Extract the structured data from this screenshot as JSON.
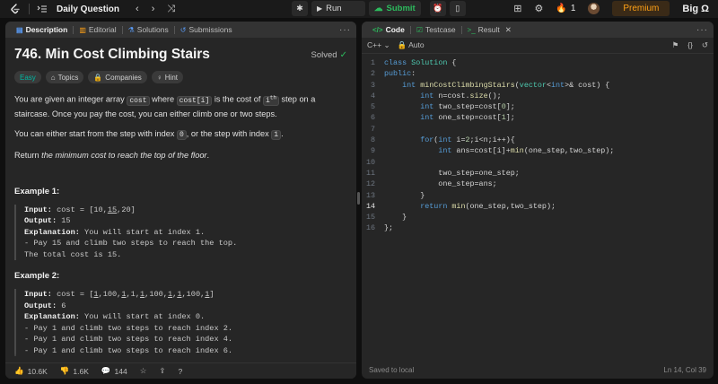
{
  "topbar": {
    "title": "Daily Question",
    "run_label": "Run",
    "submit_label": "Submit",
    "streak_count": "1",
    "premium_label": "Premium",
    "brand_text": "Big Ω"
  },
  "left_tabs": [
    {
      "label": "Description",
      "icon": "description-icon"
    },
    {
      "label": "Editorial",
      "icon": "editorial-icon"
    },
    {
      "label": "Solutions",
      "icon": "flask-icon"
    },
    {
      "label": "Submissions",
      "icon": "history-icon"
    }
  ],
  "problem": {
    "title": "746. Min Cost Climbing Stairs",
    "status": "Solved",
    "difficulty": "Easy",
    "tags": [
      "Topics",
      "Companies",
      "Hint"
    ],
    "p1_a": "You are given an integer array ",
    "p1_code1": "cost",
    "p1_b": " where ",
    "p1_code2": "cost[i]",
    "p1_c": " is the cost of ",
    "p1_code3": "i",
    "p1_sup": "th",
    "p1_d": " step on a staircase. Once you pay the cost, you can either climb one or two steps.",
    "p2_a": "You can either start from the step with index ",
    "p2_code1": "0",
    "p2_b": ", or the step with index ",
    "p2_code2": "1",
    "p2_c": ".",
    "p3_a": "Return ",
    "p3_em": "the minimum cost to reach the top of the floor",
    "p3_b": ".",
    "example1_title": "Example 1:",
    "example2_title": "Example 2:"
  },
  "example1": {
    "input_label": "Input:",
    "input_prefix": " cost = [10,",
    "input_ul": "15",
    "input_suffix": ",20]",
    "output_label": "Output:",
    "output_value": " 15",
    "expl_label": "Explanation:",
    "expl_text": " You will start at index 1.",
    "line1": "- Pay 15 and climb two steps to reach the top.",
    "line2": "The total cost is 15."
  },
  "example2": {
    "input_label": "Input:",
    "input_a": " cost = [",
    "input_u1": "1",
    "input_b": ",100,",
    "input_u2": "1",
    "input_c": ",1,",
    "input_u3": "1",
    "input_d": ",100,",
    "input_u4": "1",
    "input_e": ",",
    "input_u5": "1",
    "input_f": ",100,",
    "input_u6": "1",
    "input_g": "]",
    "output_label": "Output:",
    "output_value": " 6",
    "expl_label": "Explanation:",
    "expl_text": " You will start at index 0.",
    "line1": "- Pay 1 and climb two steps to reach index 2.",
    "line2": "- Pay 1 and climb two steps to reach index 4.",
    "line3": "- Pay 1 and climb two steps to reach index 6."
  },
  "bottom": {
    "likes": "10.6K",
    "dislikes": "1.6K",
    "comments": "144"
  },
  "right_tabs": [
    {
      "label": "Code",
      "icon": "code-icon"
    },
    {
      "label": "Testcase",
      "icon": "checkbox-icon"
    },
    {
      "label": "Result",
      "icon": "terminal-icon"
    }
  ],
  "editor": {
    "language": "C++",
    "mode": "Auto",
    "status_left": "Saved to local",
    "status_right": "Ln 14, Col 39",
    "current_line": 14,
    "lines": [
      "class Solution {",
      "public:",
      "    int minCostClimbingStairs(vector<int>& cost) {",
      "        int n=cost.size();",
      "        int two_step=cost[0];",
      "        int one_step=cost[1];",
      "",
      "        for(int i=2;i<n;i++){",
      "            int ans=cost[i]+min(one_step,two_step);",
      "",
      "            two_step=one_step;",
      "            one_step=ans;",
      "        }",
      "        return min(one_step,two_step);",
      "    }",
      "};"
    ]
  },
  "colors": {
    "accent": "#ffa116",
    "easy": "#00b8a3",
    "solved": "#2cbb5d"
  }
}
